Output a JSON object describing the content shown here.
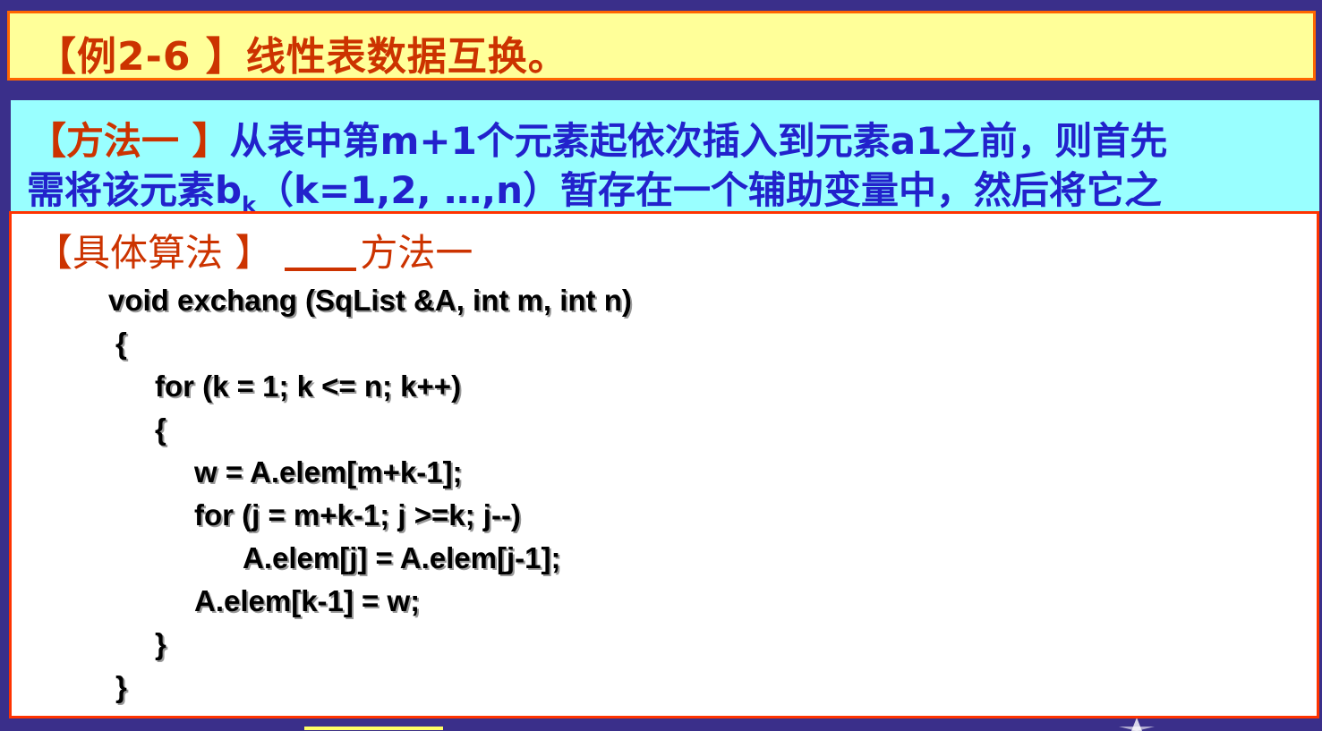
{
  "title": {
    "text": "【例2-6 】线性表数据互换。"
  },
  "method": {
    "tag": "【方法一 】",
    "line1_rest": "从表中第m+1个元素起依次插入到元素a1之前，则首先",
    "line2_pre": "需将该元素b",
    "line2_sub": "k",
    "line2_post": "（k=1,2, …,n）暂存在一个辅助变量中，然后将它之"
  },
  "algorithm": {
    "header_tag": "【具体算法 】",
    "header_label": "方法一",
    "code": [
      "void exchang (SqList &A, int m, int n)",
      "{",
      "for (k = 1; k <= n; k++)",
      "{",
      "w = A.elem[m+k-1];",
      "for (j = m+k-1; j >=k; j--)",
      "A.elem[j] = A.elem[j-1];",
      "A.elem[k-1] = w;",
      "}",
      "}"
    ]
  },
  "colors": {
    "background": "#3a2f8a",
    "title_bg": "#ffff99",
    "title_border": "#ff6600",
    "title_text": "#cc3300",
    "method_bg": "#99ffff",
    "method_text": "#2222cc",
    "code_border": "#ff3300"
  }
}
